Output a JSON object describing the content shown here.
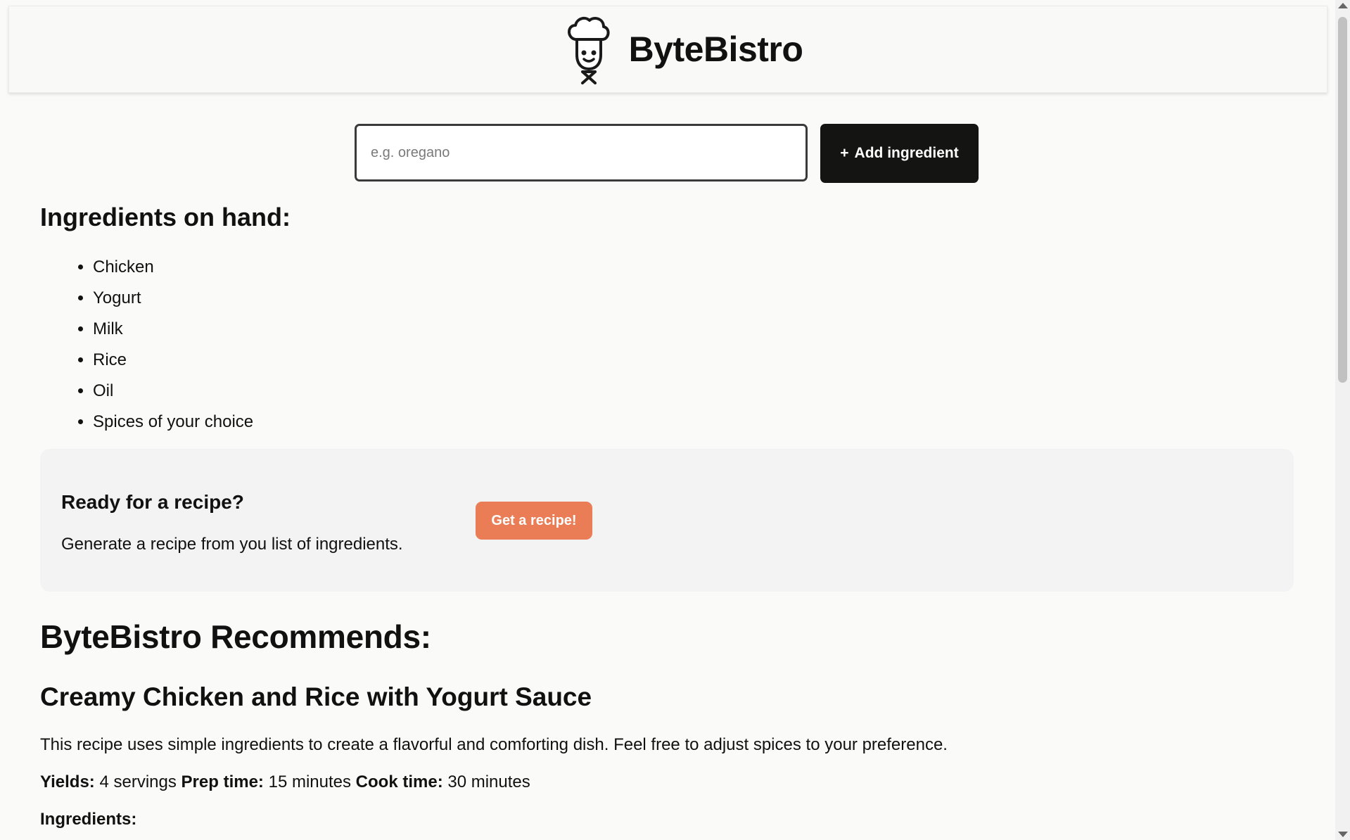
{
  "header": {
    "brand_name": "ByteBistro",
    "logo_icon": "chef-icon"
  },
  "add_ingredient": {
    "placeholder": "e.g. oregano",
    "value": "",
    "button_symbol": "+",
    "button_label": "Add ingredient"
  },
  "on_hand": {
    "title": "Ingredients on hand:",
    "items": [
      "Chicken",
      "Yogurt",
      "Milk",
      "Rice",
      "Oil",
      "Spices of your choice"
    ]
  },
  "cta": {
    "title": "Ready for a recipe?",
    "text": "Generate a recipe from you list of ingredients.",
    "button_label": "Get a recipe!"
  },
  "recommendation": {
    "section_title": "ByteBistro Recommends:",
    "recipe_name": "Creamy Chicken and Rice with Yogurt Sauce",
    "description": "This recipe uses simple ingredients to create a flavorful and comforting dish. Feel free to adjust spices to your preference.",
    "yields_label": "Yields:",
    "yields_value": "4 servings",
    "prep_label": "Prep time:",
    "prep_value": "15 minutes",
    "cook_label": "Cook time:",
    "cook_value": "30 minutes",
    "ingredients_heading": "Ingredients:"
  },
  "colors": {
    "accent": "#ea7d55",
    "dark_button": "#141413",
    "background": "#fafaf9"
  }
}
